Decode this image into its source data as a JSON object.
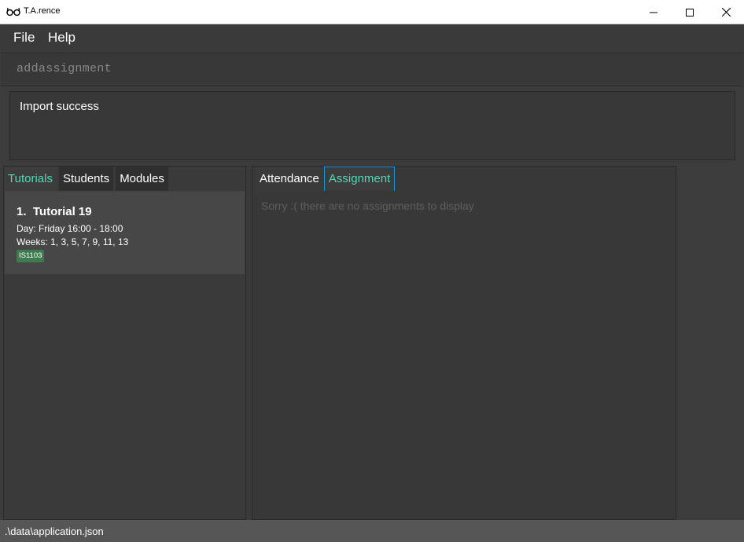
{
  "window": {
    "title": "T.A.rence",
    "icon": "glasses-icon",
    "controls": [
      "minimize-icon",
      "maximize-icon",
      "close-icon"
    ]
  },
  "menu": {
    "items": [
      {
        "label": "File"
      },
      {
        "label": "Help"
      }
    ]
  },
  "command": {
    "value": "addassignment"
  },
  "result": {
    "message": "Import success"
  },
  "left_tabs": [
    {
      "label": "Tutorials",
      "active": true
    },
    {
      "label": "Students",
      "active": false
    },
    {
      "label": "Modules",
      "active": false
    }
  ],
  "tutorials": [
    {
      "index": "1.",
      "name": "Tutorial 19",
      "day": "Day: Friday 16:00 - 18:00",
      "weeks": "Weeks: 1, 3, 5, 7, 9, 11, 13",
      "module_tag": "IS1103"
    }
  ],
  "right_tabs": [
    {
      "label": "Attendance",
      "active": false
    },
    {
      "label": "Assignment",
      "active": true
    }
  ],
  "assignments": {
    "empty_message": "Sorry :( there are no assignments to display"
  },
  "status": {
    "file_path": ".\\data\\application.json"
  },
  "colors": {
    "accent": "#55d7b6",
    "active_tab_border": "#1f8fd6",
    "tag": "#3e7b4f",
    "background": "#3c3c3c"
  }
}
